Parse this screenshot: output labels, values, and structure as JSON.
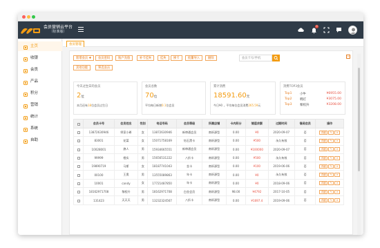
{
  "app": {
    "title": "会员营销云平台",
    "edition": "（标准版）",
    "notification_count": "0"
  },
  "colors": {
    "topbar": "#2f3b47",
    "accent": "#f39c12",
    "danger": "#e74c3c"
  },
  "sidebar": {
    "items": [
      {
        "label": "主页",
        "icon": "home-icon",
        "active": true
      },
      {
        "label": "收银",
        "icon": "cashier-icon"
      },
      {
        "label": "会员",
        "icon": "member-icon"
      },
      {
        "label": "产品",
        "icon": "product-icon"
      },
      {
        "label": "积分",
        "icon": "points-icon"
      },
      {
        "label": "营销",
        "icon": "marketing-icon"
      },
      {
        "label": "统计",
        "icon": "stats-icon"
      },
      {
        "label": "系统",
        "icon": "system-icon"
      },
      {
        "label": "自助",
        "icon": "self-service-icon"
      }
    ]
  },
  "tab": {
    "label": "会员管理"
  },
  "toolbar": {
    "buttons": [
      "新增会员 ✚",
      "会员密码",
      "账户充值",
      "补卡挂失",
      "挂失",
      "换卡",
      "批量导入",
      "删除"
    ],
    "second_row": [
      "其他功能",
      "筛选会员"
    ],
    "search_placeholder": "会员卡号/手机"
  },
  "cards": {
    "today": {
      "title": "今天过生日的会员",
      "value": "2",
      "unit": "位",
      "note_pre": "本月还有",
      "note_num": "18",
      "note_post": "位会员过生日"
    },
    "total": {
      "title": "会员总数",
      "value": "70",
      "unit": "位",
      "note_pre": "平均每日新增",
      "note_num": "0.1",
      "note_post": "位会员"
    },
    "spend": {
      "title": "累计消费",
      "value": "18591.60",
      "unit": "元",
      "note_pre": "今日¥0 ，平均每位会员消费",
      "note_num": "265.59",
      "note_post": "元"
    },
    "top3": {
      "title": "消费TOP3会员",
      "rows": [
        {
          "rank": "Top1",
          "name": "小牛",
          "amount": "¥6955.00"
        },
        {
          "rank": "Top2",
          "name": "韩灯",
          "amount": "¥3075.00"
        },
        {
          "rank": "Top3",
          "name": "黎权升",
          "amount": "¥3208.00"
        }
      ]
    }
  },
  "table": {
    "columns": [
      "",
      "会员卡号",
      "会员姓名",
      "性别",
      "电话号码",
      "会员等级",
      "所属店铺",
      "卡内积分",
      "储值余额",
      "过期时间",
      "借阅会员",
      "操作"
    ],
    "rows": [
      [
        "13872630946",
        "师家小希",
        "女",
        "13872630946",
        "新审通会员",
        "南昕源型",
        "0.00",
        "¥0",
        "2020-09-07",
        "否"
      ],
      [
        "83001",
        "花菜",
        "女",
        "15071758169",
        "钻石黑卡",
        "南昕源型",
        "0.00",
        "¥500",
        "永久有效",
        "否"
      ],
      [
        "10028001",
        "旗人",
        "男",
        "15934665551",
        "新审通会员",
        "南昕源型",
        "0.00",
        "¥100000",
        "2020-09-07",
        "否"
      ],
      [
        "99999",
        "橙实",
        "男",
        "15656531222",
        "八折卡",
        "南昕源型",
        "0.00",
        "¥500",
        "永久有效",
        "否"
      ],
      [
        "19890719",
        "马斯",
        "女",
        "18187741043",
        "金卡",
        "南昕源型",
        "0.00",
        "¥100",
        "2019-06-06",
        "否"
      ],
      [
        "00100",
        "王奥",
        "男",
        "13555089863",
        "年卡",
        "南昕源型",
        "0.00",
        "¥0",
        "永久有效",
        "否"
      ],
      [
        "10001",
        "candy",
        "女",
        "17721487850",
        "年卡",
        "南昕源型",
        "0.00",
        "¥0",
        "2018-09-06",
        "否"
      ],
      [
        "18162971708",
        "黎权升",
        "男",
        "18162971708",
        "白金会员",
        "南昕源型",
        "98.00",
        "¥4792",
        "2017-10-05",
        "否"
      ],
      [
        "131423",
        "天天天",
        "男",
        "13232324567",
        "八折卡",
        "南昕源型",
        "0.00",
        "¥1697.4",
        "2019-09-06",
        "否"
      ]
    ],
    "actions": {
      "detail": "详细",
      "edit": "✎",
      "del": "✕"
    }
  }
}
